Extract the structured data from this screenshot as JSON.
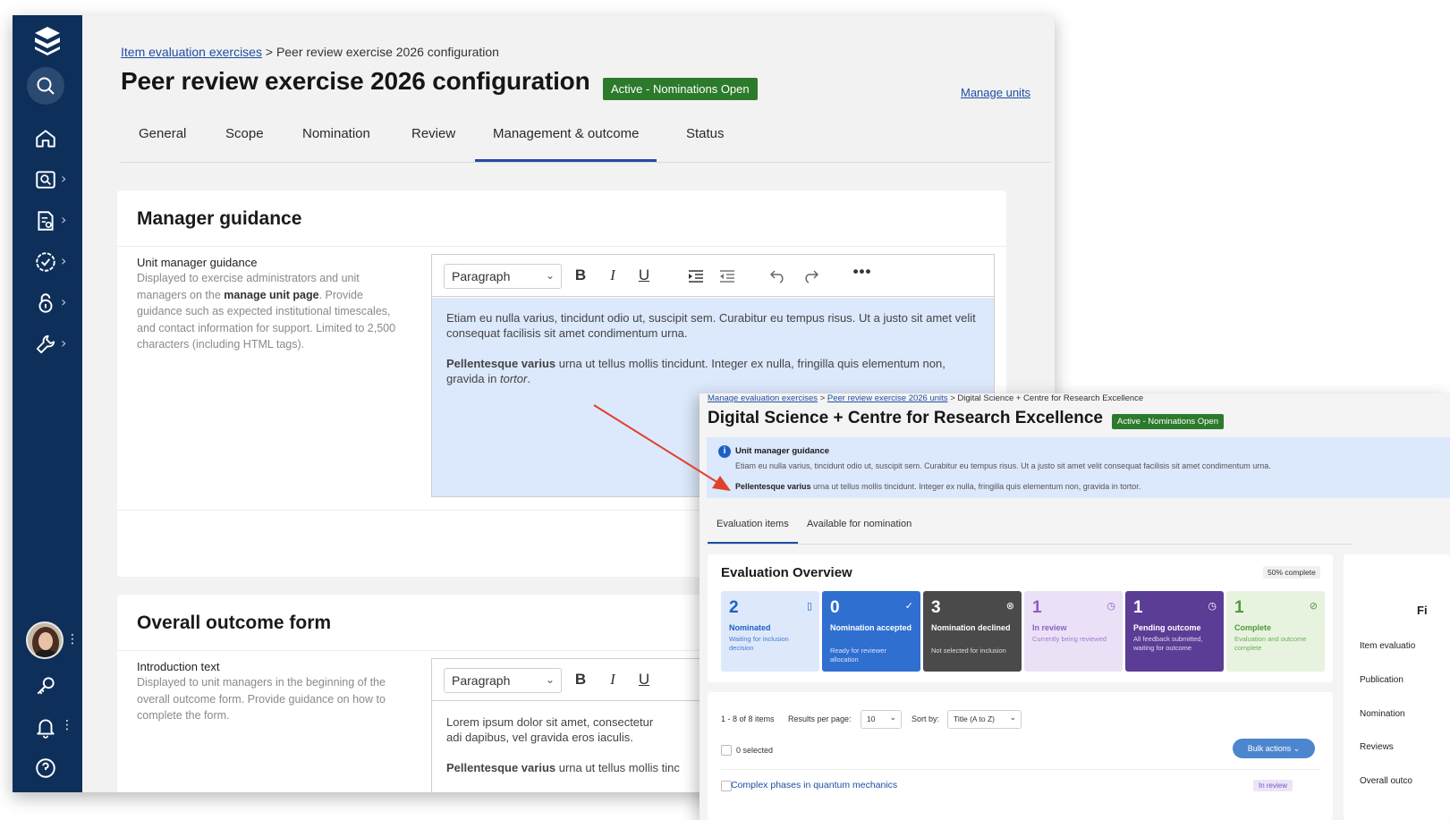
{
  "config_page": {
    "breadcrumb_link": "Item evaluation exercises",
    "breadcrumb_sep": ">",
    "breadcrumb_current": "Peer review exercise 2026 configuration",
    "title": "Peer review exercise 2026 configuration",
    "status_badge": "Active - Nominations Open",
    "manage_units_link": "Manage units",
    "tabs": [
      {
        "label": "General"
      },
      {
        "label": "Scope"
      },
      {
        "label": "Nomination"
      },
      {
        "label": "Review"
      },
      {
        "label": "Management & outcome",
        "active": true
      },
      {
        "label": "Status"
      }
    ],
    "manager_guidance": {
      "title": "Manager guidance",
      "field_label": "Unit manager guidance",
      "desc_1": "Displayed to exercise administrators and unit managers on the",
      "desc_bold": "manage unit page",
      "desc_2": ". Provide guidance such as expected institutional timescales, and contact information for support. Limited to 2,500 characters (including HTML tags).",
      "editor_select": "Paragraph",
      "editor_p1": "Etiam eu nulla varius, tincidunt odio ut, suscipit sem. Curabitur eu tempus risus. Ut a justo sit amet velit consequat facilisis sit amet condimentum urna.",
      "editor_p2_bold": "Pellentesque varius",
      "editor_p2_text": " urna ut tellus mollis tincidunt. Integer ex nulla, fringilla quis elementum non, gravida in ",
      "editor_p2_italic": "tortor",
      "editor_p2_end": "."
    },
    "outcome_form": {
      "title": "Overall outcome form",
      "field_label": "Introduction text",
      "desc": "Displayed to unit managers in the beginning of the overall outcome form. Provide guidance on how to complete the form.",
      "editor_select": "Paragraph",
      "editor_p1": "Lorem ipsum dolor sit amet, consectetur adi dapibus, vel gravida eros iaculis.",
      "editor_p2_bold": "Pellentesque varius",
      "editor_p2_text": " urna ut tellus mollis tinc"
    },
    "toolbar_icons": [
      "bold-icon",
      "italic-icon",
      "underline-icon",
      "indent-icon",
      "outdent-icon",
      "undo-icon",
      "redo-icon",
      "more-icon"
    ]
  },
  "unit_page": {
    "breadcrumb_link1": "Manage evaluation exercises",
    "breadcrumb_link2": "Peer review exercise 2026 units",
    "breadcrumb_current": "Digital Science + Centre for Research Excellence",
    "breadcrumb_sep": ">",
    "title": "Digital Science + Centre for Research Excellence",
    "status_badge": "Active - Nominations Open",
    "guidance_info": "i",
    "guidance_title": "Unit manager guidance",
    "guidance_p1": "Etiam eu nulla varius, tincidunt odio ut, suscipit sem. Curabitur eu tempus risus. Ut a justo sit amet velit consequat facilisis sit amet condimentum urna.",
    "guidance_p2_bold": "Pellentesque varius",
    "guidance_p2_text": " urna ut tellus mollis tincidunt. Integer ex nulla, fringilla quis elementum non, gravida in tortor.",
    "tabs": [
      {
        "label": "Evaluation items",
        "active": true
      },
      {
        "label": "Available for nomination"
      }
    ],
    "overview": {
      "title": "Evaluation Overview",
      "percent_label": "50% complete",
      "stats": [
        {
          "count": "2",
          "label": "Nominated",
          "sub": "Waiting for inclusion decision",
          "bg": "#dde9fb",
          "fg": "#1f5fc4",
          "icon": "document-icon",
          "glyph": "▯"
        },
        {
          "count": "0",
          "label": "Nomination accepted",
          "sub": "Ready for reviewer allocation",
          "bg": "#2f6fd0",
          "fg": "#ffffff",
          "icon": "check-icon",
          "glyph": "✓"
        },
        {
          "count": "3",
          "label": "Nomination declined",
          "sub": "Not selected for inclusion",
          "bg": "#4a4a4a",
          "fg": "#ffffff",
          "icon": "cancel-icon",
          "glyph": "⊗"
        },
        {
          "count": "1",
          "label": "In review",
          "sub": "Currently being reviewed",
          "bg": "#ebe1f6",
          "fg": "#8a5fc6",
          "icon": "clock-icon",
          "glyph": "◷"
        },
        {
          "count": "1",
          "label": "Pending outcome",
          "sub": "All feedback submitted, waiting for outcome",
          "bg": "#5b3d96",
          "fg": "#ffffff",
          "icon": "clock-icon",
          "glyph": "◷"
        },
        {
          "count": "1",
          "label": "Complete",
          "sub": "Evaluation and outcome complete",
          "bg": "#e7f3df",
          "fg": "#4f9a3a",
          "icon": "check-circle-icon",
          "glyph": "⊘"
        }
      ]
    },
    "right_panel": {
      "heading": "Fi",
      "items": [
        "Item evaluatio",
        "Publication",
        "Nomination",
        "Reviews",
        "Overall outco"
      ]
    },
    "items": {
      "count_text": "1 - 8 of 8 items",
      "per_page_label": "Results per page:",
      "per_page_value": "10",
      "sort_label": "Sort by:",
      "sort_value": "Title (A to Z)",
      "selected_text": "0 selected",
      "bulk_label": "Bulk actions",
      "first_item": "Complex phases in quantum mechanics",
      "first_item_status": "In review"
    }
  },
  "annotation": {
    "arrow_color": "#e0412b"
  }
}
